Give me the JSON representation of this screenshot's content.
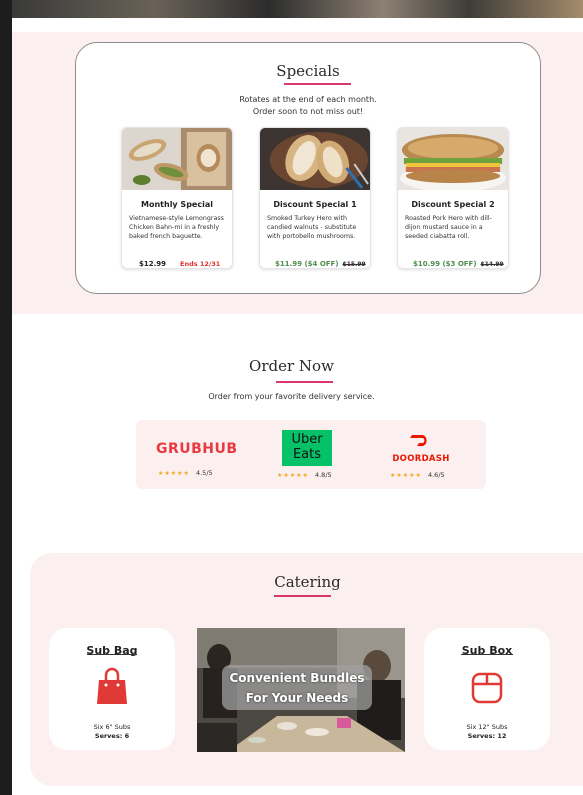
{
  "specials": {
    "title": "Specials",
    "subtitle_line1": "Rotates at the end of each month.",
    "subtitle_line2": "Order soon to not miss out!",
    "items": [
      {
        "name": "Monthly Special",
        "desc": "Vietnamese-style Lemongrass Chicken Bahn-mi in a freshly baked french baguette.",
        "price": "$12.99",
        "note": "Ends 12/31"
      },
      {
        "name": "Discount Special 1",
        "desc": "Smoked Turkey Hero with candied walnuts - substitute with portobello mushrooms.",
        "price": "$11.99 ($4 OFF)",
        "original": "$15.99"
      },
      {
        "name": "Discount Special 2",
        "desc": "Roasted Pork Hero with dill-dijon mustard sauce in a seeded ciabatta roll.",
        "price": "$10.99 ($3 OFF)",
        "original": "$14.99"
      }
    ]
  },
  "order": {
    "title": "Order Now",
    "subtitle": "Order from your favorite delivery service.",
    "services": [
      {
        "brand": "GRUBHUB",
        "rating": "4.5/5",
        "stars": "★★★★★",
        "color": "#e8393f"
      },
      {
        "brand_line1": "Uber",
        "brand_line2": "Eats",
        "rating": "4.8/5",
        "stars": "★★★★★",
        "color": "#06c167"
      },
      {
        "brand": "DOORDASH",
        "rating": "4.6/5",
        "stars": "★★★★★",
        "color": "#eb1700"
      }
    ]
  },
  "catering": {
    "title": "Catering",
    "sub_bag": {
      "title": "Sub Bag",
      "size": "Six 6\" Subs",
      "serves": "Serves: 6",
      "icon": "shopping-bag-icon"
    },
    "photo_line1": "Convenient Bundles",
    "photo_line2": "For Your Needs",
    "sub_box": {
      "title": "Sub Box",
      "size": "Six 12\" Subs",
      "serves": "Serves: 12",
      "icon": "box-icon"
    }
  },
  "colors": {
    "accent": "#d9386b",
    "band": "#fcefef",
    "discount": "#4f8d4f",
    "ends": "#e03030",
    "icon_red": "#e03a36"
  }
}
